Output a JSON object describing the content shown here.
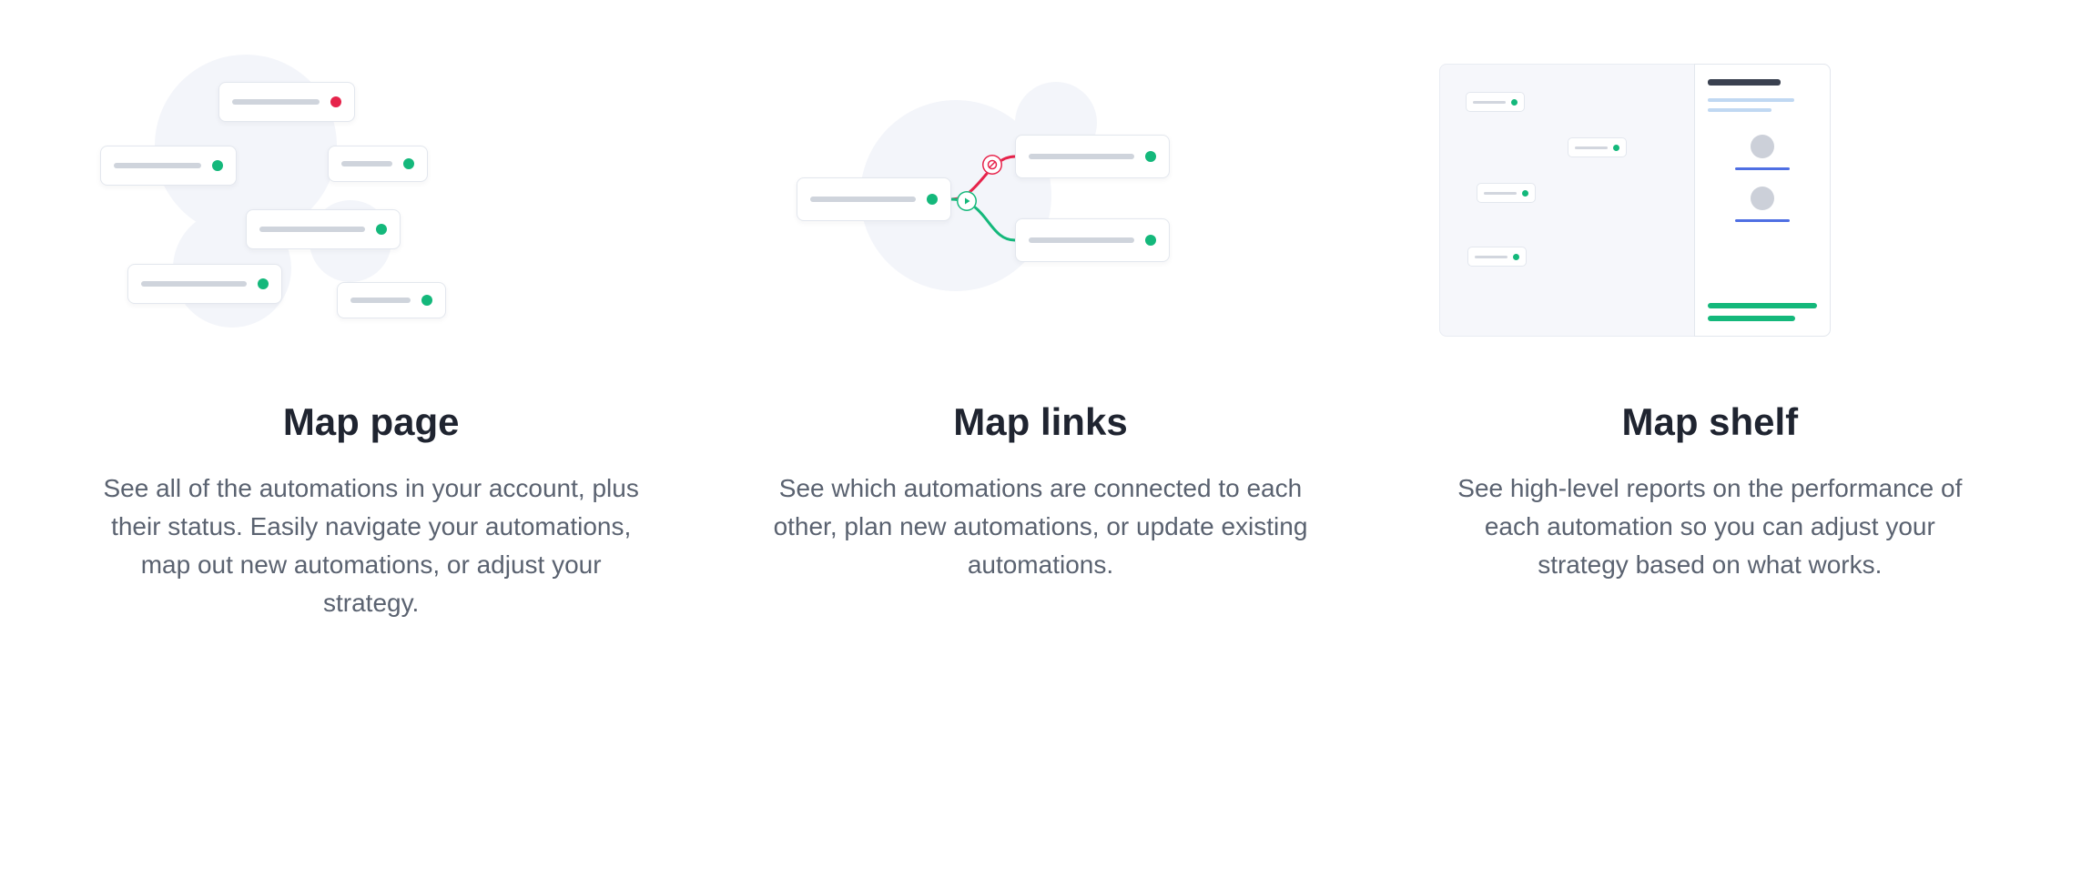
{
  "features": [
    {
      "title": "Map page",
      "description": "See all of the automations in your account, plus their status. Easily navigate your automations, map out new automations, or adjust your strategy."
    },
    {
      "title": "Map links",
      "description": "See which automations are connected to each other, plan new automations, or update existing automations."
    },
    {
      "title": "Map shelf",
      "description": "See high-level reports on the performance of each automation so you can adjust your strategy based on what works."
    }
  ],
  "colors": {
    "green": "#14b87b",
    "red": "#e6234b",
    "blue": "#4f6fe3",
    "text": "#1f2430",
    "muted": "#5a6270"
  },
  "icons": {
    "play": "play-icon",
    "stop": "stop-icon"
  }
}
